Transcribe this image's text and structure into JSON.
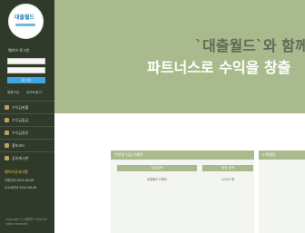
{
  "brand": {
    "logo_text": "대출월드"
  },
  "sidebar": {
    "login_title": "웨이브 로그인",
    "id_placeholder": "아이디",
    "pw_placeholder": "비밀번호",
    "login_button": "로그인",
    "links": [
      "회원가입",
      "ID/PW찾기"
    ],
    "menu": [
      "수익금현황",
      "수익금출금",
      "수익금정산",
      "홍보코드",
      "공지게시판"
    ],
    "notice_title": "웨이브공지사항",
    "notices": [
      "지원안내 2024-08-08",
      "수수료안내 2024-08-08"
    ],
    "copyright": "copyright ⓒ 대출월드 2024 All rights reserved."
  },
  "hero": {
    "title": "`대출월드`와 함께",
    "subtitle": "파트너스로 수익을 창출"
  },
  "panels": {
    "left_title": "이번달 지급 이벤트",
    "table_headers": [
      "지급금액",
      "정산 금액"
    ],
    "table_row": [
      "대출월드이벤트",
      "4,500 원"
    ],
    "right_title": "누적랭킹"
  },
  "colors": {
    "sidebar": "#2f3a2b",
    "accent": "#a9bb8c",
    "button": "#3da6e4"
  }
}
